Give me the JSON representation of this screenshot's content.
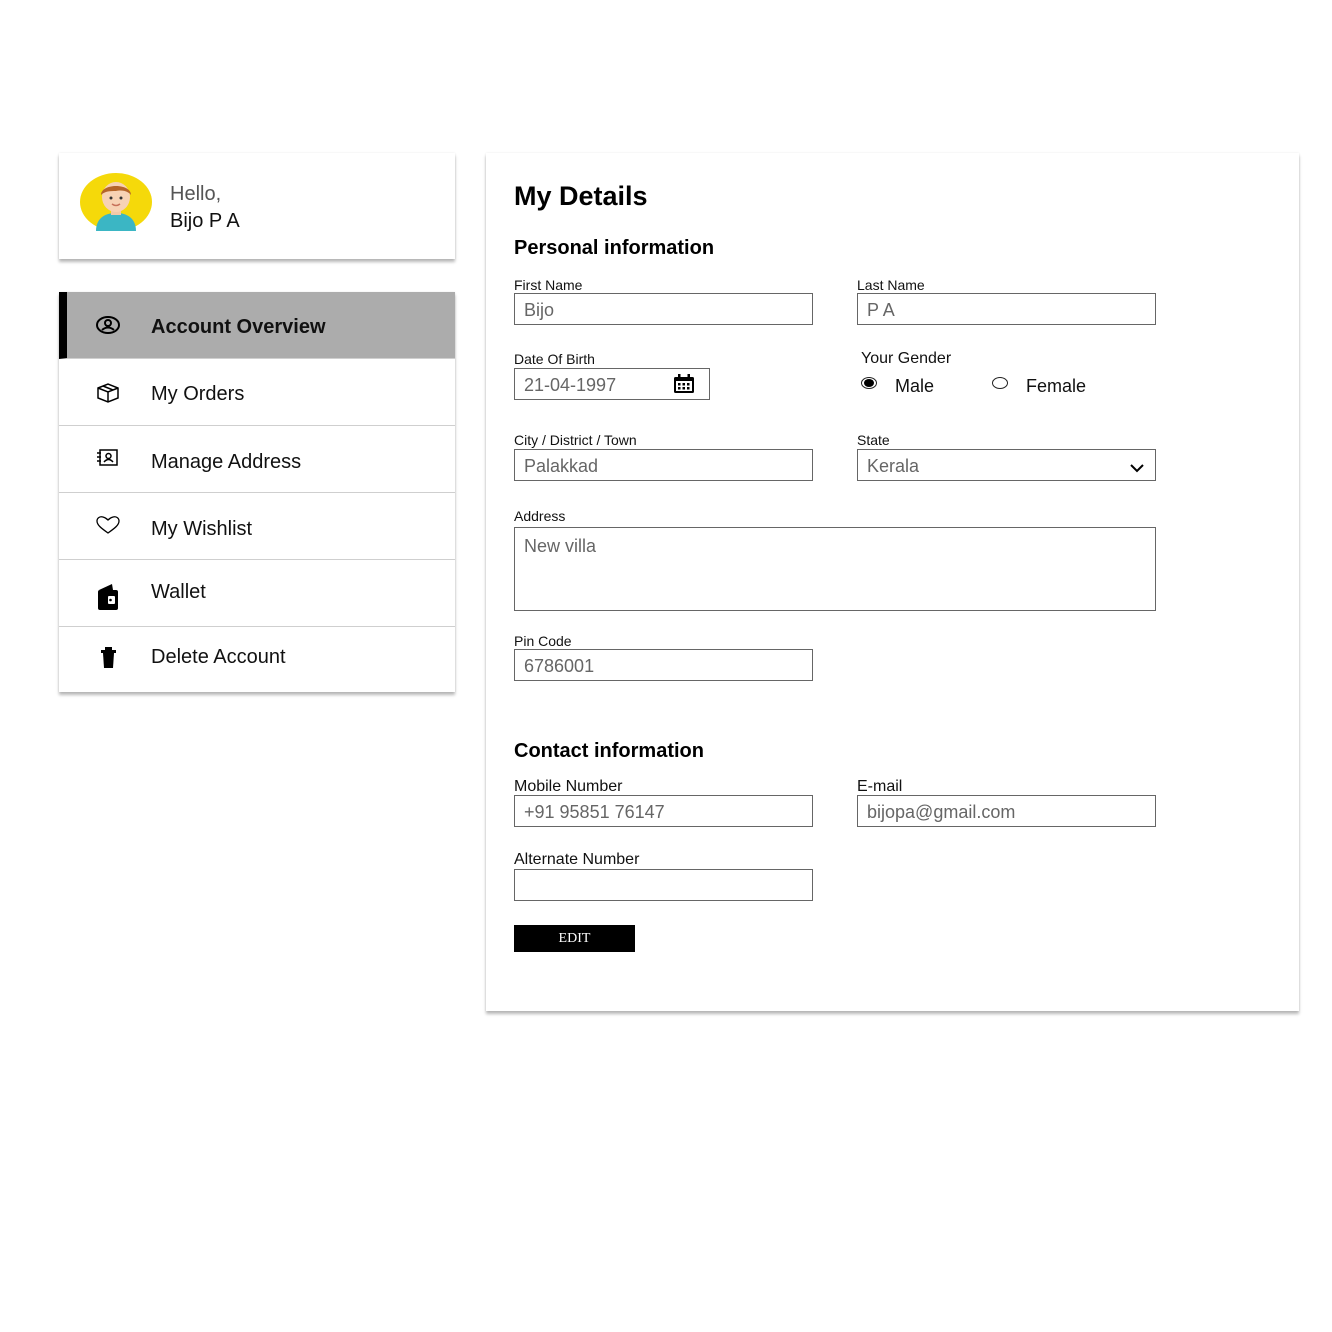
{
  "profile": {
    "greeting": "Hello,",
    "name": "Bijo P A",
    "avatar_icon": "user-avatar-icon"
  },
  "menu": [
    {
      "label": "Account Overview",
      "icon": "account-icon",
      "active": true
    },
    {
      "label": "My Orders",
      "icon": "box-icon"
    },
    {
      "label": "Manage Address",
      "icon": "address-book-icon"
    },
    {
      "label": "My Wishlist",
      "icon": "heart-icon"
    },
    {
      "label": "Wallet",
      "icon": "wallet-icon"
    },
    {
      "label": "Delete Account",
      "icon": "trash-icon"
    }
  ],
  "details": {
    "title": "My Details",
    "personal_heading": "Personal information",
    "first_name": {
      "label": "First Name",
      "value": "Bijo"
    },
    "last_name": {
      "label": "Last Name",
      "value": "P A"
    },
    "dob": {
      "label": "Date Of Birth",
      "value": "21-04-1997"
    },
    "gender": {
      "label": "Your Gender",
      "options": [
        "Male",
        "Female"
      ],
      "selected": "Male"
    },
    "city": {
      "label": "City / District / Town",
      "value": "Palakkad"
    },
    "state": {
      "label": "State",
      "value": "Kerala"
    },
    "address": {
      "label": "Address",
      "value": "New villa"
    },
    "pincode": {
      "label": "Pin Code",
      "value": "6786001"
    },
    "contact_heading": "Contact information",
    "mobile": {
      "label": "Mobile Number",
      "value": "+91 95851 76147"
    },
    "email": {
      "label": "E-mail",
      "value": "bijopa@gmail.com"
    },
    "alternate": {
      "label": "Alternate Number",
      "value": ""
    },
    "edit_label": "EDIT"
  },
  "colors": {
    "active_bg": "#acacac",
    "active_bar": "#000000",
    "avatar_bg": "#f5d90a",
    "button_bg": "#000000"
  }
}
